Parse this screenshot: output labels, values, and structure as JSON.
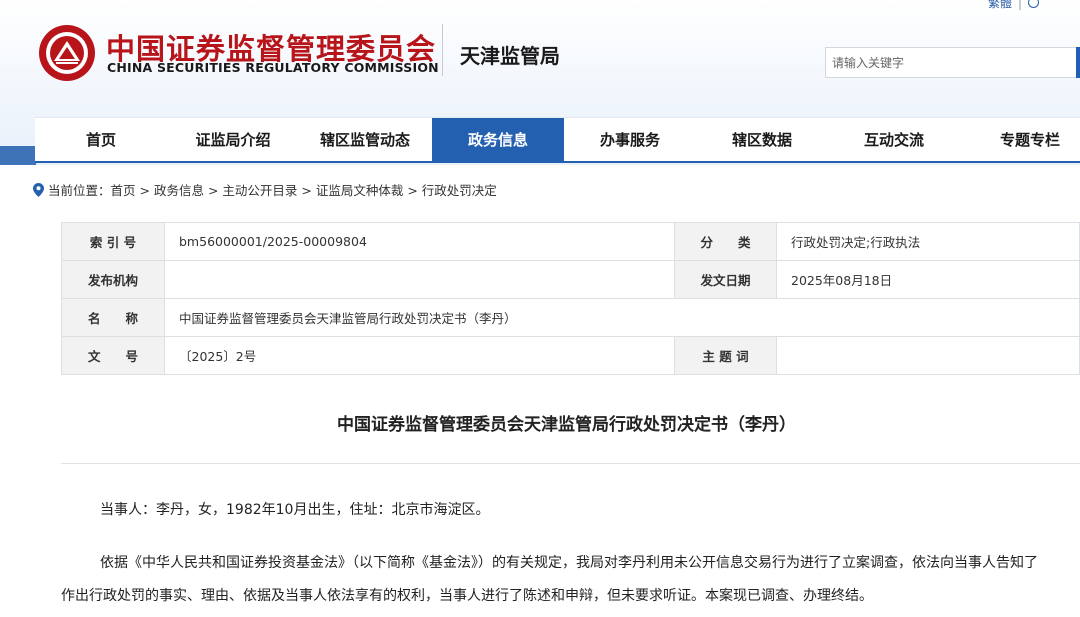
{
  "header": {
    "top_link": "繁體",
    "title_cn": "中国证券监督管理委员会",
    "title_en": "CHINA SECURITIES REGULATORY COMMISSION",
    "bureau": "天津监管局",
    "search_placeholder": "请输入关键字"
  },
  "nav": {
    "items": [
      "首页",
      "证监局介绍",
      "辖区监管动态",
      "政务信息",
      "办事服务",
      "辖区数据",
      "互动交流",
      "专题专栏"
    ],
    "active_index": 3
  },
  "breadcrumb": {
    "prefix": "当前位置：",
    "items": [
      "首页",
      "政务信息",
      "主动公开目录",
      "证监局文种体裁",
      "行政处罚决定"
    ],
    "separator": " > "
  },
  "meta": {
    "index_label": "索 引 号",
    "index_value": "bm56000001/2025-00009804",
    "category_label": "分　　类",
    "category_value": "行政处罚决定;行政执法",
    "issuer_label": "发布机构",
    "issuer_value": "",
    "date_label": "发文日期",
    "date_value": "2025年08月18日",
    "name_label": "名　　称",
    "name_value": "中国证券监督管理委员会天津监管局行政处罚决定书（李丹）",
    "docno_label": "文　　号",
    "docno_value": "〔2025〕2号",
    "keywords_label": "主 题 词",
    "keywords_value": ""
  },
  "document": {
    "title": "中国证券监督管理委员会天津监管局行政处罚决定书（李丹）",
    "para1": "当事人：李丹，女，1982年10月出生，住址：北京市海淀区。",
    "para2": "依据《中华人民共和国证券投资基金法》（以下简称《基金法》）的有关规定，我局对李丹利用未公开信息交易行为进行了立案调查，依法向当事人告知了",
    "para3": "作出行政处罚的事实、理由、依据及当事人依法享有的权利，当事人进行了陈述和申辩，但未要求听证。本案现已调查、办理终结。"
  },
  "colors": {
    "brand_red": "#b8151b",
    "nav_blue": "#2361b0"
  }
}
